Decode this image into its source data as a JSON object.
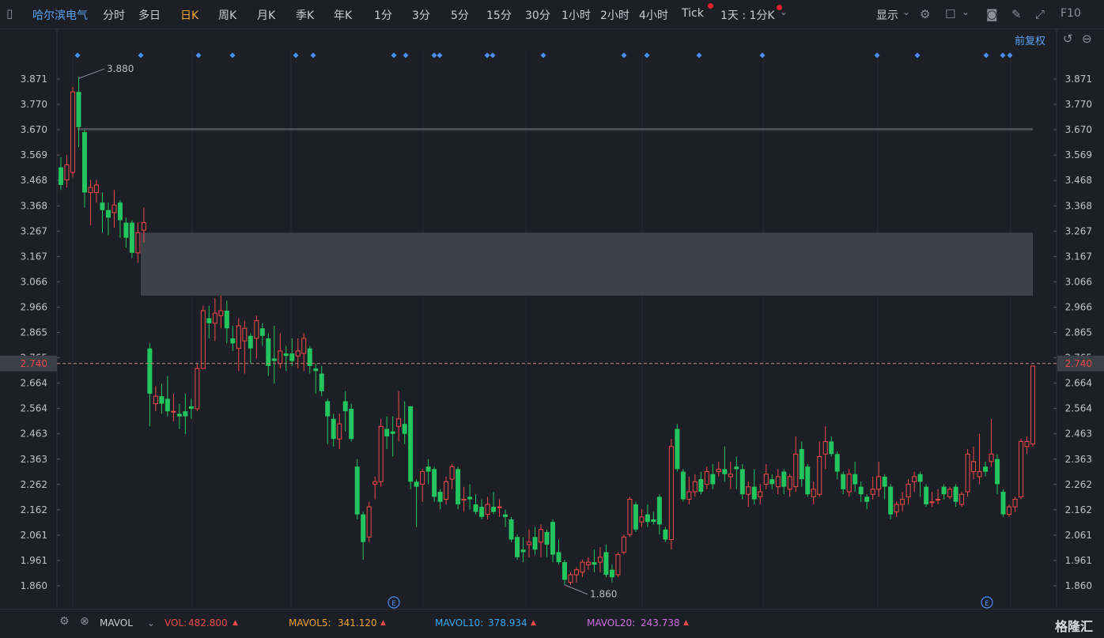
{
  "toolbar": {
    "stock_name": "哈尔滨电气",
    "periods": [
      "分时",
      "多日",
      "日K",
      "周K",
      "月K",
      "季K",
      "年K",
      "1分",
      "3分",
      "5分",
      "15分",
      "30分",
      "1小时",
      "2小时",
      "4小时",
      "Tick"
    ],
    "active_period": "日K",
    "multi_period": "1天 : 1分K",
    "display": "显示",
    "f10": "F10"
  },
  "restore_label": "前复权",
  "current_price_tag": "2.740",
  "high_label": "3.880",
  "low_label": "1.860",
  "event_marker": "E",
  "indicators": {
    "name": "MAVOL",
    "vol_label": "VOL:",
    "vol_value": "482.800",
    "mavol5_label": "MAVOL5:",
    "mavol5_value": "341.120",
    "mavol10_label": "MAVOL10:",
    "mavol10_value": "378.934",
    "mavol20_label": "MAVOL20:",
    "mavol20_value": "243.738"
  },
  "brand": "格隆汇",
  "colors": {
    "up": "#f04a4a",
    "down": "#22c55e",
    "accent": "#f0a632",
    "link": "#5aa0f0"
  },
  "chart_data": {
    "type": "candlestick",
    "y_ticks": [
      "3.871",
      "3.770",
      "3.670",
      "3.569",
      "3.468",
      "3.368",
      "3.267",
      "3.167",
      "3.066",
      "2.966",
      "2.865",
      "2.765",
      "2.664",
      "2.564",
      "2.463",
      "2.363",
      "2.262",
      "2.162",
      "2.061",
      "1.961",
      "1.860"
    ],
    "ylim": [
      1.8,
      3.95
    ],
    "last_price": 2.74,
    "resistance_line": 3.67,
    "zone": [
      3.01,
      3.26
    ],
    "candles": [
      [
        3.52,
        3.45,
        3.56,
        3.43
      ],
      [
        3.47,
        3.53,
        3.57,
        3.44
      ],
      [
        3.5,
        3.82,
        3.84,
        3.48
      ],
      [
        3.82,
        3.68,
        3.88,
        3.6
      ],
      [
        3.66,
        3.42,
        3.67,
        3.36
      ],
      [
        3.42,
        3.44,
        3.47,
        3.29
      ],
      [
        3.42,
        3.45,
        3.47,
        3.38
      ],
      [
        3.38,
        3.35,
        3.42,
        3.26
      ],
      [
        3.35,
        3.32,
        3.38,
        3.25
      ],
      [
        3.34,
        3.37,
        3.43,
        3.28
      ],
      [
        3.38,
        3.31,
        3.39,
        3.24
      ],
      [
        3.3,
        3.24,
        3.32,
        3.2
      ],
      [
        3.3,
        3.18,
        3.31,
        3.16
      ],
      [
        3.18,
        3.26,
        3.3,
        3.14
      ],
      [
        3.27,
        3.3,
        3.36,
        3.22
      ],
      [
        2.8,
        2.62,
        2.82,
        2.49
      ],
      [
        2.58,
        2.61,
        2.65,
        2.55
      ],
      [
        2.61,
        2.58,
        2.66,
        2.54
      ],
      [
        2.6,
        2.55,
        2.69,
        2.53
      ],
      [
        2.55,
        2.55,
        2.62,
        2.51
      ],
      [
        2.54,
        2.53,
        2.58,
        2.48
      ],
      [
        2.55,
        2.53,
        2.62,
        2.46
      ],
      [
        2.57,
        2.56,
        2.6,
        2.52
      ],
      [
        2.56,
        2.72,
        2.74,
        2.55
      ],
      [
        2.72,
        2.95,
        2.97,
        2.72
      ],
      [
        2.92,
        2.9,
        2.97,
        2.84
      ],
      [
        2.9,
        2.94,
        3.0,
        2.83
      ],
      [
        2.93,
        2.95,
        3.01,
        2.88
      ],
      [
        2.95,
        2.88,
        2.99,
        2.82
      ],
      [
        2.84,
        2.82,
        2.89,
        2.79
      ],
      [
        2.8,
        2.89,
        2.92,
        2.71
      ],
      [
        2.83,
        2.88,
        2.91,
        2.7
      ],
      [
        2.85,
        2.8,
        2.86,
        2.74
      ],
      [
        2.84,
        2.91,
        2.93,
        2.76
      ],
      [
        2.88,
        2.85,
        2.9,
        2.81
      ],
      [
        2.84,
        2.73,
        2.86,
        2.69
      ],
      [
        2.76,
        2.75,
        2.89,
        2.66
      ],
      [
        2.74,
        2.79,
        2.86,
        2.72
      ],
      [
        2.78,
        2.77,
        2.81,
        2.71
      ],
      [
        2.78,
        2.75,
        2.84,
        2.73
      ],
      [
        2.77,
        2.79,
        2.84,
        2.72
      ],
      [
        2.78,
        2.84,
        2.86,
        2.71
      ],
      [
        2.8,
        2.73,
        2.81,
        2.7
      ],
      [
        2.72,
        2.71,
        2.74,
        2.62
      ],
      [
        2.7,
        2.63,
        2.73,
        2.61
      ],
      [
        2.59,
        2.53,
        2.6,
        2.42
      ],
      [
        2.52,
        2.44,
        2.54,
        2.41
      ],
      [
        2.44,
        2.5,
        2.54,
        2.4
      ],
      [
        2.59,
        2.55,
        2.63,
        2.47
      ],
      [
        2.56,
        2.44,
        2.58,
        2.43
      ],
      [
        2.33,
        2.14,
        2.36,
        2.12
      ],
      [
        2.14,
        2.03,
        2.15,
        1.96
      ],
      [
        2.05,
        2.17,
        2.19,
        2.03
      ],
      [
        2.26,
        2.27,
        2.29,
        2.2
      ],
      [
        2.27,
        2.49,
        2.52,
        2.25
      ],
      [
        2.48,
        2.45,
        2.53,
        2.4
      ],
      [
        2.47,
        2.46,
        2.53,
        2.37
      ],
      [
        2.49,
        2.52,
        2.63,
        2.43
      ],
      [
        2.5,
        2.46,
        2.59,
        2.42
      ],
      [
        2.57,
        2.27,
        2.57,
        2.24
      ],
      [
        2.27,
        2.25,
        2.28,
        2.09
      ],
      [
        2.26,
        2.31,
        2.32,
        2.19
      ],
      [
        2.33,
        2.31,
        2.36,
        2.26
      ],
      [
        2.32,
        2.21,
        2.33,
        2.19
      ],
      [
        2.23,
        2.19,
        2.24,
        2.16
      ],
      [
        2.2,
        2.27,
        2.29,
        2.18
      ],
      [
        2.28,
        2.33,
        2.34,
        2.24
      ],
      [
        2.32,
        2.18,
        2.33,
        2.16
      ],
      [
        2.2,
        2.2,
        2.25,
        2.15
      ],
      [
        2.21,
        2.2,
        2.26,
        2.16
      ],
      [
        2.18,
        2.15,
        2.22,
        2.14
      ],
      [
        2.17,
        2.13,
        2.2,
        2.12
      ],
      [
        2.14,
        2.18,
        2.21,
        2.12
      ],
      [
        2.17,
        2.15,
        2.23,
        2.14
      ],
      [
        2.17,
        2.17,
        2.2,
        2.13
      ],
      [
        2.14,
        2.13,
        2.16,
        2.09
      ],
      [
        2.12,
        2.04,
        2.13,
        2.03
      ],
      [
        2.05,
        1.97,
        2.06,
        1.96
      ],
      [
        2.0,
        1.99,
        2.05,
        1.95
      ],
      [
        2.02,
        2.03,
        2.08,
        1.97
      ],
      [
        2.05,
        2.0,
        2.09,
        1.98
      ],
      [
        2.03,
        2.08,
        2.1,
        1.97
      ],
      [
        2.07,
        2.02,
        2.08,
        1.97
      ],
      [
        2.11,
        1.98,
        2.12,
        1.95
      ],
      [
        1.99,
        1.95,
        2.04,
        1.94
      ],
      [
        1.95,
        1.88,
        1.96,
        1.86
      ],
      [
        1.87,
        1.9,
        1.91,
        1.86
      ],
      [
        1.9,
        1.92,
        1.93,
        1.87
      ],
      [
        1.91,
        1.95,
        1.96,
        1.89
      ],
      [
        1.94,
        1.95,
        1.97,
        1.92
      ],
      [
        1.95,
        1.94,
        2.0,
        1.91
      ],
      [
        1.95,
        1.97,
        2.01,
        1.91
      ],
      [
        1.99,
        1.9,
        2.02,
        1.89
      ],
      [
        1.92,
        1.89,
        1.94,
        1.87
      ],
      [
        1.9,
        1.98,
        1.99,
        1.89
      ],
      [
        1.99,
        2.05,
        2.06,
        1.98
      ],
      [
        2.06,
        2.2,
        2.21,
        2.05
      ],
      [
        2.18,
        2.08,
        2.19,
        2.07
      ],
      [
        2.11,
        2.13,
        2.16,
        2.09
      ],
      [
        2.14,
        2.11,
        2.18,
        2.09
      ],
      [
        2.12,
        2.11,
        2.15,
        2.1
      ],
      [
        2.21,
        2.1,
        2.22,
        2.06
      ],
      [
        2.08,
        2.04,
        2.09,
        2.03
      ],
      [
        2.04,
        2.41,
        2.44,
        2.0
      ],
      [
        2.48,
        2.32,
        2.5,
        2.31
      ],
      [
        2.31,
        2.2,
        2.32,
        2.19
      ],
      [
        2.2,
        2.23,
        2.29,
        2.18
      ],
      [
        2.23,
        2.27,
        2.3,
        2.21
      ],
      [
        2.28,
        2.23,
        2.31,
        2.22
      ],
      [
        2.26,
        2.31,
        2.33,
        2.24
      ],
      [
        2.3,
        2.26,
        2.34,
        2.24
      ],
      [
        2.31,
        2.32,
        2.35,
        2.29
      ],
      [
        2.32,
        2.3,
        2.41,
        2.27
      ],
      [
        2.29,
        2.3,
        2.35,
        2.24
      ],
      [
        2.33,
        2.32,
        2.37,
        2.24
      ],
      [
        2.32,
        2.22,
        2.34,
        2.2
      ],
      [
        2.22,
        2.25,
        2.27,
        2.17
      ],
      [
        2.25,
        2.2,
        2.32,
        2.18
      ],
      [
        2.21,
        2.23,
        2.26,
        2.18
      ],
      [
        2.26,
        2.3,
        2.34,
        2.24
      ],
      [
        2.28,
        2.26,
        2.3,
        2.24
      ],
      [
        2.25,
        2.29,
        2.32,
        2.22
      ],
      [
        2.31,
        2.25,
        2.32,
        2.22
      ],
      [
        2.24,
        2.29,
        2.3,
        2.21
      ],
      [
        2.25,
        2.38,
        2.45,
        2.23
      ],
      [
        2.4,
        2.28,
        2.43,
        2.25
      ],
      [
        2.33,
        2.22,
        2.34,
        2.21
      ],
      [
        2.21,
        2.24,
        2.27,
        2.18
      ],
      [
        2.22,
        2.37,
        2.43,
        2.21
      ],
      [
        2.38,
        2.43,
        2.49,
        2.32
      ],
      [
        2.43,
        2.38,
        2.45,
        2.37
      ],
      [
        2.38,
        2.31,
        2.39,
        2.28
      ],
      [
        2.3,
        2.24,
        2.31,
        2.22
      ],
      [
        2.23,
        2.3,
        2.32,
        2.21
      ],
      [
        2.3,
        2.26,
        2.35,
        2.23
      ],
      [
        2.25,
        2.22,
        2.27,
        2.19
      ],
      [
        2.21,
        2.19,
        2.22,
        2.16
      ],
      [
        2.22,
        2.24,
        2.29,
        2.2
      ],
      [
        2.24,
        2.29,
        2.35,
        2.21
      ],
      [
        2.29,
        2.25,
        2.3,
        2.2
      ],
      [
        2.25,
        2.14,
        2.26,
        2.12
      ],
      [
        2.15,
        2.18,
        2.19,
        2.13
      ],
      [
        2.18,
        2.2,
        2.23,
        2.15
      ],
      [
        2.21,
        2.26,
        2.28,
        2.18
      ],
      [
        2.27,
        2.29,
        2.31,
        2.23
      ],
      [
        2.3,
        2.27,
        2.31,
        2.21
      ],
      [
        2.25,
        2.18,
        2.26,
        2.17
      ],
      [
        2.19,
        2.19,
        2.23,
        2.17
      ],
      [
        2.2,
        2.2,
        2.24,
        2.18
      ],
      [
        2.25,
        2.22,
        2.26,
        2.2
      ],
      [
        2.21,
        2.24,
        2.25,
        2.2
      ],
      [
        2.25,
        2.19,
        2.26,
        2.17
      ],
      [
        2.18,
        2.22,
        2.23,
        2.17
      ],
      [
        2.23,
        2.38,
        2.4,
        2.21
      ],
      [
        2.31,
        2.35,
        2.41,
        2.28
      ],
      [
        2.29,
        2.31,
        2.46,
        2.26
      ],
      [
        2.33,
        2.31,
        2.35,
        2.29
      ],
      [
        2.35,
        2.38,
        2.52,
        2.33
      ],
      [
        2.36,
        2.26,
        2.38,
        2.22
      ],
      [
        2.23,
        2.14,
        2.24,
        2.13
      ],
      [
        2.14,
        2.17,
        2.18,
        2.13
      ],
      [
        2.17,
        2.2,
        2.21,
        2.15
      ],
      [
        2.21,
        2.43,
        2.44,
        2.2
      ],
      [
        2.41,
        2.43,
        2.45,
        2.38
      ],
      [
        2.42,
        2.73,
        2.73,
        2.41
      ]
    ],
    "marker_rows": "top-markers",
    "event_positions": [
      "mid",
      "late"
    ]
  }
}
